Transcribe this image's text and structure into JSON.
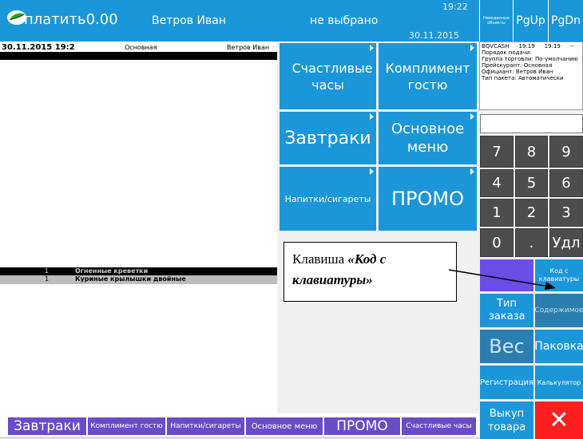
{
  "topbar": {
    "pay_label": "платить0.00",
    "waiter": "Ветров Иван",
    "table": "не выбрано",
    "time": "19:22",
    "date": "30.11.2015"
  },
  "top_buttons": {
    "info_label": "Наведенные объекты",
    "pgup": "PgUp",
    "pgdn": "PgDn"
  },
  "order": {
    "header_date": "30.11.2015 19:2",
    "header_menu": "Основная",
    "header_waiter": "Ветров Иван",
    "items": [
      {
        "qty": "1",
        "name": "Огненные креветки"
      },
      {
        "qty": "1",
        "name": "Куриные крылышки двойные"
      }
    ]
  },
  "menu_buttons": [
    {
      "label": "Счастливые часы"
    },
    {
      "label": "Комплимент гостю"
    },
    {
      "label": "Завтраки"
    },
    {
      "label": "Основное меню"
    },
    {
      "label": "Напитки/сигареты"
    },
    {
      "label": "ПРОМО"
    }
  ],
  "info_panel": {
    "station": "BQVCASH",
    "t1": "19:19",
    "t2": "19:19",
    "t3": "--",
    "lines": [
      "Порядок подачи:",
      "Группа торговли: По-умолчанию",
      "Прейскурант: Основная",
      "Официант: Ветров Иван",
      "Тип пакета: Автоматически"
    ]
  },
  "keypad": {
    "keys": [
      "7",
      "8",
      "9",
      "4",
      "5",
      "6",
      "1",
      "2",
      "3",
      "0",
      ".",
      "Удл"
    ]
  },
  "callout": {
    "prefix": "Клавиша ",
    "bold": "«Код с клавиатуры»"
  },
  "right_buttons": {
    "code": "Код с клавиатуры",
    "order_type": "Тип заказа",
    "content": "Содержимое",
    "weight": "Вес",
    "pack": "Паковка",
    "register": "Регистрация",
    "calculator": "Калькулятор",
    "checkout": "Выкуп товара",
    "close": "✕"
  },
  "tabs": [
    {
      "label": "Завтраки"
    },
    {
      "label": "Комплимент гостю"
    },
    {
      "label": "Напитки/сигареты"
    },
    {
      "label": "Основное меню"
    },
    {
      "label": "ПРОМО"
    },
    {
      "label": "Счастливые часы"
    }
  ],
  "colors": {
    "accent_blue": "#1b96d8",
    "tab_purple": "#6a4cc7",
    "key_gray": "#4d4d4d",
    "close_red": "#ff1f1f",
    "code_button_purple": "#6b4ce6"
  }
}
